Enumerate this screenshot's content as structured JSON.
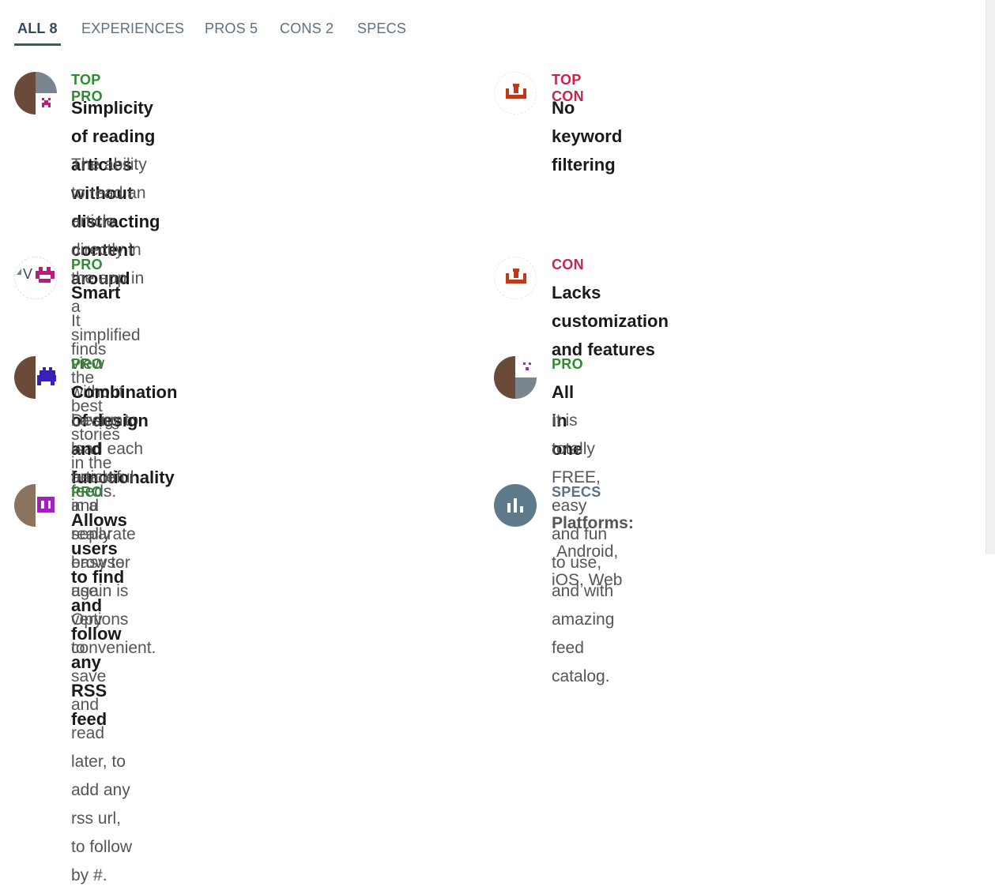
{
  "tabs": [
    {
      "label": "ALL 8"
    },
    {
      "label": "EXPERIENCES"
    },
    {
      "label": "PROS 5"
    },
    {
      "label": "CONS 2"
    },
    {
      "label": "SPECS"
    }
  ],
  "items": [
    {
      "kind": "TOP PRO",
      "title_line1": "Simplicity of reading articles without distracting",
      "title_line2": "content around",
      "desc_line1": "The ability to read an article directly in the app in a",
      "desc_line2": "simplified view without having to load each article",
      "desc_line3": "in a separate browser again is very convenient."
    },
    {
      "kind": "TOP CON",
      "title": "No keyword filtering"
    },
    {
      "kind": "PRO",
      "title": "Smart",
      "desc": "It finds the best stories in the feeds."
    },
    {
      "kind": "CON",
      "title": "Lacks customization and features"
    },
    {
      "kind": "PRO",
      "title": "Combination of design and functionality",
      "desc_line1": "Design is beautiful and really easy to use. Options to",
      "desc_line2": "save and read later, to add any rss url, to follow by #."
    },
    {
      "kind": "PRO",
      "title": "All in one",
      "desc_line1": "It is totally FREE, easy and fun to use, and with",
      "desc_line2": "amazing feed catalog."
    },
    {
      "kind": "PRO",
      "title": "Allows users to find and follow any RSS feed"
    },
    {
      "kind": "SPECS",
      "spec_label": "Platforms:",
      "spec_value": "Android, iOS, Web"
    }
  ],
  "colors": {
    "pro": "#2e8b30",
    "con": "#c7254e",
    "specs": "#5c7182",
    "specs_icon_bg": "#5f7a8a",
    "con_icon": "#c0391b"
  }
}
